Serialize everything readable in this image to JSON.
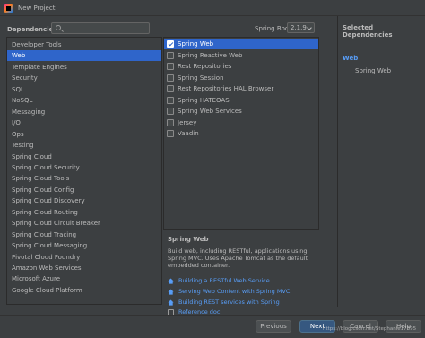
{
  "window": {
    "title": "New Project"
  },
  "header": {
    "dependencies_label": "Dependencies",
    "spring_boot_label": "Spring Boot",
    "spring_boot_version": "2.1.9"
  },
  "categories": [
    {
      "label": "Developer Tools",
      "selected": false
    },
    {
      "label": "Web",
      "selected": true
    },
    {
      "label": "Template Engines",
      "selected": false
    },
    {
      "label": "Security",
      "selected": false
    },
    {
      "label": "SQL",
      "selected": false
    },
    {
      "label": "NoSQL",
      "selected": false
    },
    {
      "label": "Messaging",
      "selected": false
    },
    {
      "label": "I/O",
      "selected": false
    },
    {
      "label": "Ops",
      "selected": false
    },
    {
      "label": "Testing",
      "selected": false
    },
    {
      "label": "Spring Cloud",
      "selected": false
    },
    {
      "label": "Spring Cloud Security",
      "selected": false
    },
    {
      "label": "Spring Cloud Tools",
      "selected": false
    },
    {
      "label": "Spring Cloud Config",
      "selected": false
    },
    {
      "label": "Spring Cloud Discovery",
      "selected": false
    },
    {
      "label": "Spring Cloud Routing",
      "selected": false
    },
    {
      "label": "Spring Cloud Circuit Breaker",
      "selected": false
    },
    {
      "label": "Spring Cloud Tracing",
      "selected": false
    },
    {
      "label": "Spring Cloud Messaging",
      "selected": false
    },
    {
      "label": "Pivotal Cloud Foundry",
      "selected": false
    },
    {
      "label": "Amazon Web Services",
      "selected": false
    },
    {
      "label": "Microsoft Azure",
      "selected": false
    },
    {
      "label": "Google Cloud Platform",
      "selected": false
    }
  ],
  "dependencies": [
    {
      "label": "Spring Web",
      "checked": true,
      "selected": true
    },
    {
      "label": "Spring Reactive Web",
      "checked": false,
      "selected": false
    },
    {
      "label": "Rest Repositories",
      "checked": false,
      "selected": false
    },
    {
      "label": "Spring Session",
      "checked": false,
      "selected": false
    },
    {
      "label": "Rest Repositories HAL Browser",
      "checked": false,
      "selected": false
    },
    {
      "label": "Spring HATEOAS",
      "checked": false,
      "selected": false
    },
    {
      "label": "Spring Web Services",
      "checked": false,
      "selected": false
    },
    {
      "label": "Jersey",
      "checked": false,
      "selected": false
    },
    {
      "label": "Vaadin",
      "checked": false,
      "selected": false
    }
  ],
  "description": {
    "title": "Spring Web",
    "body": "Build web, including RESTful, applications using Spring MVC. Uses Apache Tomcat as the default embedded container.",
    "links": [
      {
        "label": "Building a RESTful Web Service",
        "icon": "home-icon"
      },
      {
        "label": "Serving Web Content with Spring MVC",
        "icon": "home-icon"
      },
      {
        "label": "Building REST services with Spring",
        "icon": "home-icon"
      },
      {
        "label": "Reference doc",
        "icon": "reference-doc-icon"
      }
    ]
  },
  "selected_panel": {
    "title": "Selected Dependencies",
    "group": "Web",
    "items": [
      "Spring Web"
    ]
  },
  "buttons": {
    "previous": "Previous",
    "next": "Next",
    "cancel": "Cancel",
    "help": "Help"
  },
  "watermark": "https://blog.csdn.net/Stephanie17395",
  "colors": {
    "background": "#3c3f41",
    "selection": "#2f65ca",
    "link": "#589df6",
    "primary_button": "#365880"
  }
}
